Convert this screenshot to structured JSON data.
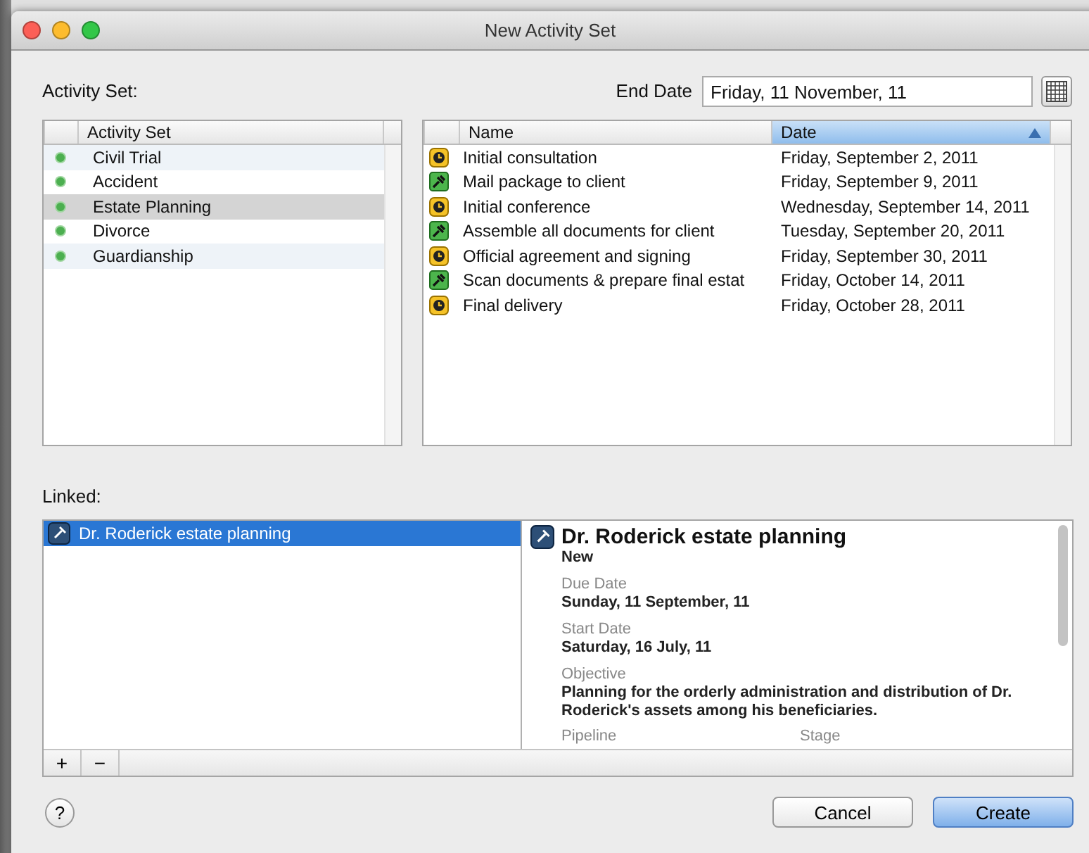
{
  "window": {
    "title": "New Activity Set"
  },
  "activity_set_label": "Activity Set:",
  "end_date": {
    "label": "End Date",
    "value": "Friday, 11 November, 11"
  },
  "activity_sets": {
    "columns": [
      "Activity Set"
    ],
    "rows": [
      {
        "name": "Civil Trial",
        "selected": false
      },
      {
        "name": "Accident",
        "selected": false
      },
      {
        "name": "Estate Planning",
        "selected": true
      },
      {
        "name": "Divorce",
        "selected": false
      },
      {
        "name": "Guardianship",
        "selected": false
      }
    ]
  },
  "activities": {
    "columns": [
      {
        "label": "Name",
        "sorted": false
      },
      {
        "label": "Date",
        "sorted": true
      }
    ],
    "rows": [
      {
        "kind": "appointment",
        "name": "Initial consultation",
        "date": "Friday, September 2, 2011"
      },
      {
        "kind": "task",
        "name": "Mail package to client",
        "date": "Friday, September 9, 2011"
      },
      {
        "kind": "appointment",
        "name": "Initial conference",
        "date": "Wednesday, September 14, 2011"
      },
      {
        "kind": "task",
        "name": "Assemble all documents for client",
        "date": "Tuesday, September 20, 2011"
      },
      {
        "kind": "appointment",
        "name": "Official agreement and signing",
        "date": "Friday, September 30, 2011"
      },
      {
        "kind": "task",
        "name": "Scan documents & prepare final estat",
        "date": "Friday, October 14, 2011"
      },
      {
        "kind": "appointment",
        "name": "Final delivery",
        "date": "Friday, October 28, 2011"
      }
    ]
  },
  "linked": {
    "label": "Linked:",
    "items": [
      {
        "name": "Dr. Roderick estate planning",
        "selected": true
      }
    ],
    "buttons": [
      "+",
      "−"
    ],
    "detail": {
      "title": "Dr. Roderick estate planning",
      "status": "New",
      "fields": [
        {
          "label": "Due Date",
          "value": "Sunday, 11 September, 11"
        },
        {
          "label": "Start Date",
          "value": "Saturday, 16 July, 11"
        },
        {
          "label": "Objective",
          "value": "Planning for the orderly administration and distribution of Dr. Roderick's assets among his beneficiaries."
        }
      ],
      "cut_labels": [
        "Pipeline",
        "Stage"
      ]
    }
  },
  "help": "?",
  "buttons": [
    {
      "label": "Cancel",
      "default": false
    },
    {
      "label": "Create",
      "default": true
    }
  ]
}
